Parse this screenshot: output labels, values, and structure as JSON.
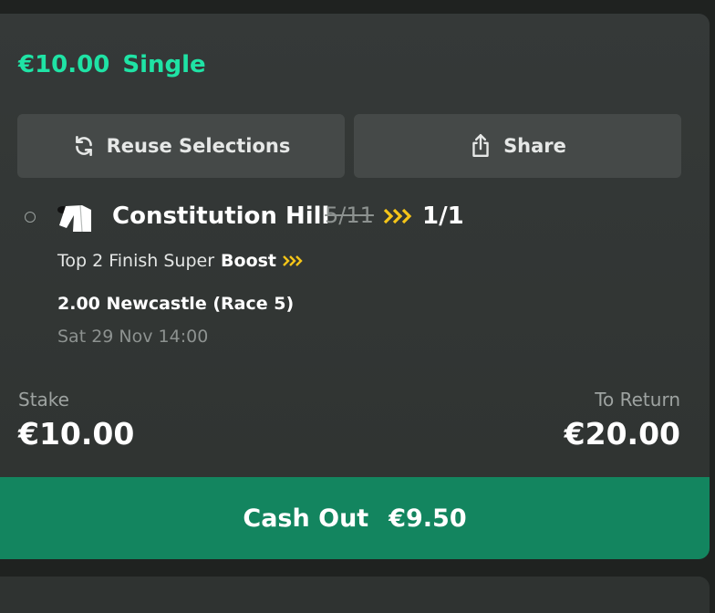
{
  "bet": {
    "stake_header": "€10.00",
    "type": "Single"
  },
  "actions": {
    "reuse_label": "Reuse Selections",
    "share_label": "Share"
  },
  "selection": {
    "name": "Constitution Hill",
    "old_odds": "5/11",
    "new_odds": "1/1",
    "market_prefix": "Top 2 Finish Super",
    "market_boost": "Boost",
    "event": "2.00 Newcastle (Race 5)",
    "datetime": "Sat 29 Nov 14:00"
  },
  "summary": {
    "stake_label": "Stake",
    "stake_value": "€10.00",
    "return_label": "To Return",
    "return_value": "€20.00"
  },
  "cashout": {
    "label": "Cash Out",
    "value": "€9.50"
  },
  "colors": {
    "accent": "#1fe3a5",
    "cashout": "#13855f",
    "boost": "#f5c518"
  }
}
